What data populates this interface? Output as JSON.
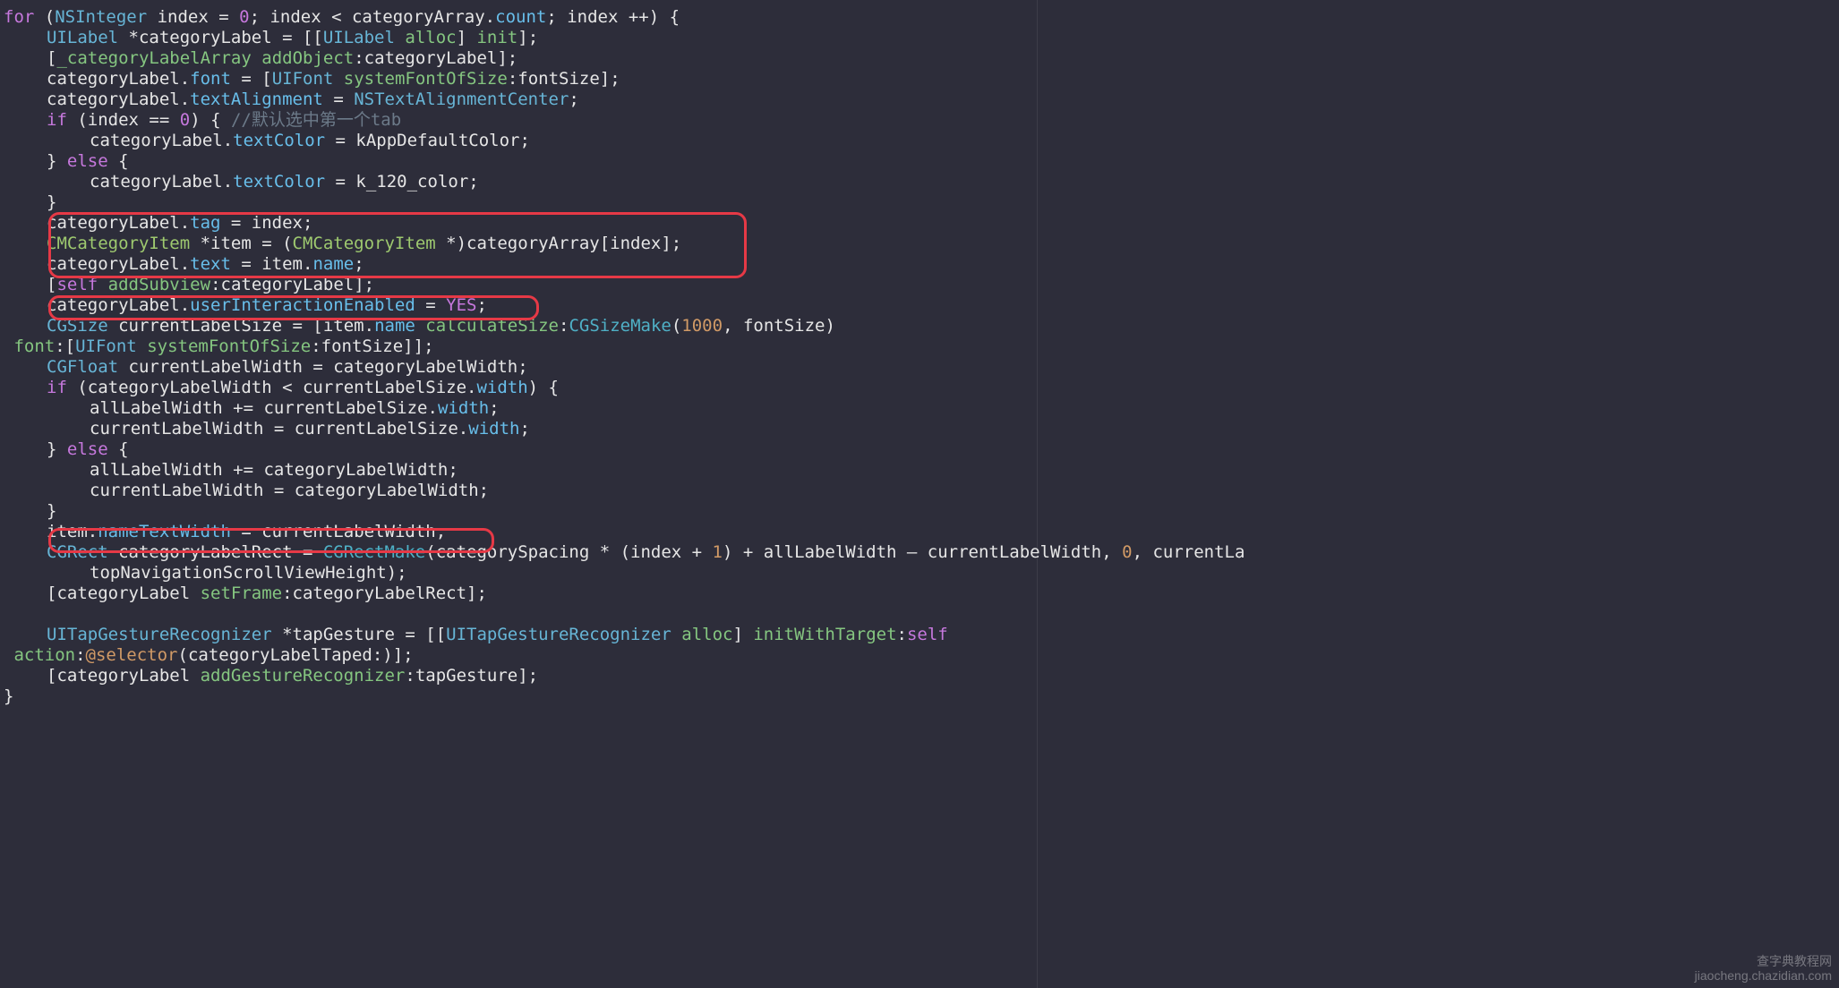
{
  "meta": {
    "language": "Objective-C",
    "editor_theme": "Monokai Dim"
  },
  "annotations": {
    "box1_lines": [
      10,
      11,
      12
    ],
    "box2_lines": [
      14
    ],
    "box3_lines": [
      25
    ]
  },
  "watermark": {
    "line1": "查字典教程网",
    "line2": "jiaocheng.chazidian.com"
  },
  "code": {
    "lines": [
      {
        "indent": 0,
        "tokens": [
          {
            "t": "for",
            "c": "kw"
          },
          {
            "t": " (",
            "c": "paren"
          },
          {
            "t": "NSInteger",
            "c": "type"
          },
          {
            "t": " index = ",
            "c": "ident"
          },
          {
            "t": "0",
            "c": "num"
          },
          {
            "t": "; index < categoryArray.",
            "c": "ident"
          },
          {
            "t": "count",
            "c": "prop"
          },
          {
            "t": "; index ++) {",
            "c": "ident"
          }
        ]
      },
      {
        "indent": 1,
        "tokens": [
          {
            "t": "UILabel",
            "c": "type"
          },
          {
            "t": " *categoryLabel = [[",
            "c": "ident"
          },
          {
            "t": "UILabel",
            "c": "type"
          },
          {
            "t": " ",
            "c": "ident"
          },
          {
            "t": "alloc",
            "c": "method"
          },
          {
            "t": "] ",
            "c": "ident"
          },
          {
            "t": "init",
            "c": "method"
          },
          {
            "t": "];",
            "c": "ident"
          }
        ]
      },
      {
        "indent": 1,
        "tokens": [
          {
            "t": "[",
            "c": "ident"
          },
          {
            "t": "_categoryLabelArray",
            "c": "method"
          },
          {
            "t": " ",
            "c": "ident"
          },
          {
            "t": "addObject",
            "c": "method"
          },
          {
            "t": ":categoryLabel];",
            "c": "ident"
          }
        ]
      },
      {
        "indent": 1,
        "tokens": [
          {
            "t": "categoryLabel.",
            "c": "ident"
          },
          {
            "t": "font",
            "c": "prop"
          },
          {
            "t": " = [",
            "c": "ident"
          },
          {
            "t": "UIFont",
            "c": "type"
          },
          {
            "t": " ",
            "c": "ident"
          },
          {
            "t": "systemFontOfSize",
            "c": "method"
          },
          {
            "t": ":fontSize];",
            "c": "ident"
          }
        ]
      },
      {
        "indent": 1,
        "tokens": [
          {
            "t": "categoryLabel.",
            "c": "ident"
          },
          {
            "t": "textAlignment",
            "c": "prop"
          },
          {
            "t": " = ",
            "c": "ident"
          },
          {
            "t": "NSTextAlignmentCenter",
            "c": "type"
          },
          {
            "t": ";",
            "c": "ident"
          }
        ]
      },
      {
        "indent": 1,
        "tokens": [
          {
            "t": "if",
            "c": "kw"
          },
          {
            "t": " (index == ",
            "c": "ident"
          },
          {
            "t": "0",
            "c": "num"
          },
          {
            "t": ") { ",
            "c": "ident"
          },
          {
            "t": "//默认选中第一个tab",
            "c": "comment"
          }
        ]
      },
      {
        "indent": 2,
        "tokens": [
          {
            "t": "categoryLabel.",
            "c": "ident"
          },
          {
            "t": "textColor",
            "c": "prop"
          },
          {
            "t": " = kAppDefaultColor;",
            "c": "ident"
          }
        ]
      },
      {
        "indent": 1,
        "tokens": [
          {
            "t": "} ",
            "c": "ident"
          },
          {
            "t": "else",
            "c": "kw"
          },
          {
            "t": " {",
            "c": "ident"
          }
        ]
      },
      {
        "indent": 2,
        "tokens": [
          {
            "t": "categoryLabel.",
            "c": "ident"
          },
          {
            "t": "textColor",
            "c": "prop"
          },
          {
            "t": " = k_120_color;",
            "c": "ident"
          }
        ]
      },
      {
        "indent": 1,
        "tokens": [
          {
            "t": "}",
            "c": "ident"
          }
        ]
      },
      {
        "indent": 1,
        "tokens": [
          {
            "t": "categoryLabel.",
            "c": "ident"
          },
          {
            "t": "tag",
            "c": "prop"
          },
          {
            "t": " = index;",
            "c": "ident"
          }
        ]
      },
      {
        "indent": 1,
        "tokens": [
          {
            "t": "CMCategoryItem",
            "c": "typegreen"
          },
          {
            "t": " *item = (",
            "c": "ident"
          },
          {
            "t": "CMCategoryItem",
            "c": "typegreen"
          },
          {
            "t": " *)categoryArray[index];",
            "c": "ident"
          }
        ]
      },
      {
        "indent": 1,
        "tokens": [
          {
            "t": "categoryLabel.",
            "c": "ident"
          },
          {
            "t": "text",
            "c": "prop"
          },
          {
            "t": " = item.",
            "c": "ident"
          },
          {
            "t": "name",
            "c": "prop"
          },
          {
            "t": ";",
            "c": "ident"
          }
        ]
      },
      {
        "indent": 1,
        "tokens": [
          {
            "t": "[",
            "c": "ident"
          },
          {
            "t": "self",
            "c": "const"
          },
          {
            "t": " ",
            "c": "ident"
          },
          {
            "t": "addSubview",
            "c": "method"
          },
          {
            "t": ":categoryLabel];",
            "c": "ident"
          }
        ]
      },
      {
        "indent": 1,
        "tokens": [
          {
            "t": "categoryLabel.",
            "c": "ident"
          },
          {
            "t": "userInteractionEnabled",
            "c": "prop"
          },
          {
            "t": " = ",
            "c": "ident"
          },
          {
            "t": "YES",
            "c": "const"
          },
          {
            "t": ";",
            "c": "ident"
          }
        ]
      },
      {
        "indent": 1,
        "tokens": [
          {
            "t": "CGSize",
            "c": "type"
          },
          {
            "t": " currentLabelSize = [item.",
            "c": "ident"
          },
          {
            "t": "name",
            "c": "prop"
          },
          {
            "t": " ",
            "c": "ident"
          },
          {
            "t": "calculateSize",
            "c": "method"
          },
          {
            "t": ":",
            "c": "ident"
          },
          {
            "t": "CGSizeMake",
            "c": "msg"
          },
          {
            "t": "(",
            "c": "ident"
          },
          {
            "t": "1000",
            "c": "numorange"
          },
          {
            "t": ", fontSize)",
            "c": "ident"
          }
        ]
      },
      {
        "indent": 0,
        "tokens": [
          {
            "t": "                                                      ",
            "c": "ident"
          },
          {
            "t": "font",
            "c": "method"
          },
          {
            "t": ":[",
            "c": "ident"
          },
          {
            "t": "UIFont",
            "c": "type"
          },
          {
            "t": " ",
            "c": "ident"
          },
          {
            "t": "systemFontOfSize",
            "c": "method"
          },
          {
            "t": ":fontSize]];",
            "c": "ident"
          }
        ]
      },
      {
        "indent": 1,
        "tokens": [
          {
            "t": "CGFloat",
            "c": "type"
          },
          {
            "t": " currentLabelWidth = categoryLabelWidth;",
            "c": "ident"
          }
        ]
      },
      {
        "indent": 1,
        "tokens": [
          {
            "t": "if",
            "c": "kw"
          },
          {
            "t": " (categoryLabelWidth < currentLabelSize.",
            "c": "ident"
          },
          {
            "t": "width",
            "c": "prop"
          },
          {
            "t": ") {",
            "c": "ident"
          }
        ]
      },
      {
        "indent": 2,
        "tokens": [
          {
            "t": "allLabelWidth += currentLabelSize.",
            "c": "ident"
          },
          {
            "t": "width",
            "c": "prop"
          },
          {
            "t": ";",
            "c": "ident"
          }
        ]
      },
      {
        "indent": 2,
        "tokens": [
          {
            "t": "currentLabelWidth = currentLabelSize.",
            "c": "ident"
          },
          {
            "t": "width",
            "c": "prop"
          },
          {
            "t": ";",
            "c": "ident"
          }
        ]
      },
      {
        "indent": 1,
        "tokens": [
          {
            "t": "} ",
            "c": "ident"
          },
          {
            "t": "else",
            "c": "kw"
          },
          {
            "t": " {",
            "c": "ident"
          }
        ]
      },
      {
        "indent": 2,
        "tokens": [
          {
            "t": "allLabelWidth += categoryLabelWidth;",
            "c": "ident"
          }
        ]
      },
      {
        "indent": 2,
        "tokens": [
          {
            "t": "currentLabelWidth = categoryLabelWidth;",
            "c": "ident"
          }
        ]
      },
      {
        "indent": 1,
        "tokens": [
          {
            "t": "}",
            "c": "ident"
          }
        ]
      },
      {
        "indent": 1,
        "tokens": [
          {
            "t": "item.",
            "c": "ident"
          },
          {
            "t": "nameTextWidth",
            "c": "prop"
          },
          {
            "t": " = currentLabelWidth;",
            "c": "ident"
          }
        ]
      },
      {
        "indent": 1,
        "tokens": [
          {
            "t": "CGRect",
            "c": "type"
          },
          {
            "t": " categoryLabelRect = ",
            "c": "ident"
          },
          {
            "t": "CGRectMake",
            "c": "msg"
          },
          {
            "t": "(categorySpacing * (index + ",
            "c": "ident"
          },
          {
            "t": "1",
            "c": "numorange"
          },
          {
            "t": ") + allLabelWidth – currentLabelWidth, ",
            "c": "ident"
          },
          {
            "t": "0",
            "c": "numorange"
          },
          {
            "t": ", currentLa",
            "c": "ident"
          }
        ]
      },
      {
        "indent": 2,
        "tokens": [
          {
            "t": "topNavigationScrollViewHeight);",
            "c": "ident"
          }
        ]
      },
      {
        "indent": 1,
        "tokens": [
          {
            "t": "[categoryLabel ",
            "c": "ident"
          },
          {
            "t": "setFrame",
            "c": "method"
          },
          {
            "t": ":categoryLabelRect];",
            "c": "ident"
          }
        ]
      },
      {
        "indent": 1,
        "tokens": [
          {
            "t": "",
            "c": "ident"
          }
        ]
      },
      {
        "indent": 1,
        "tokens": [
          {
            "t": "UITapGestureRecognizer",
            "c": "type"
          },
          {
            "t": " *tapGesture = [[",
            "c": "ident"
          },
          {
            "t": "UITapGestureRecognizer",
            "c": "type"
          },
          {
            "t": " ",
            "c": "ident"
          },
          {
            "t": "alloc",
            "c": "method"
          },
          {
            "t": "] ",
            "c": "ident"
          },
          {
            "t": "initWithTarget",
            "c": "method"
          },
          {
            "t": ":",
            "c": "ident"
          },
          {
            "t": "self",
            "c": "const"
          }
        ]
      },
      {
        "indent": 0,
        "tokens": [
          {
            "t": "                                                                                    ",
            "c": "ident"
          },
          {
            "t": "action",
            "c": "method"
          },
          {
            "t": ":",
            "c": "ident"
          },
          {
            "t": "@selector",
            "c": "sel"
          },
          {
            "t": "(categoryLabelTaped:)];",
            "c": "ident"
          }
        ]
      },
      {
        "indent": 1,
        "tokens": [
          {
            "t": "[categoryLabel ",
            "c": "ident"
          },
          {
            "t": "addGestureRecognizer",
            "c": "method"
          },
          {
            "t": ":tapGesture];",
            "c": "ident"
          }
        ]
      },
      {
        "indent": 0,
        "tokens": [
          {
            "t": "}",
            "c": "ident"
          }
        ]
      }
    ]
  }
}
